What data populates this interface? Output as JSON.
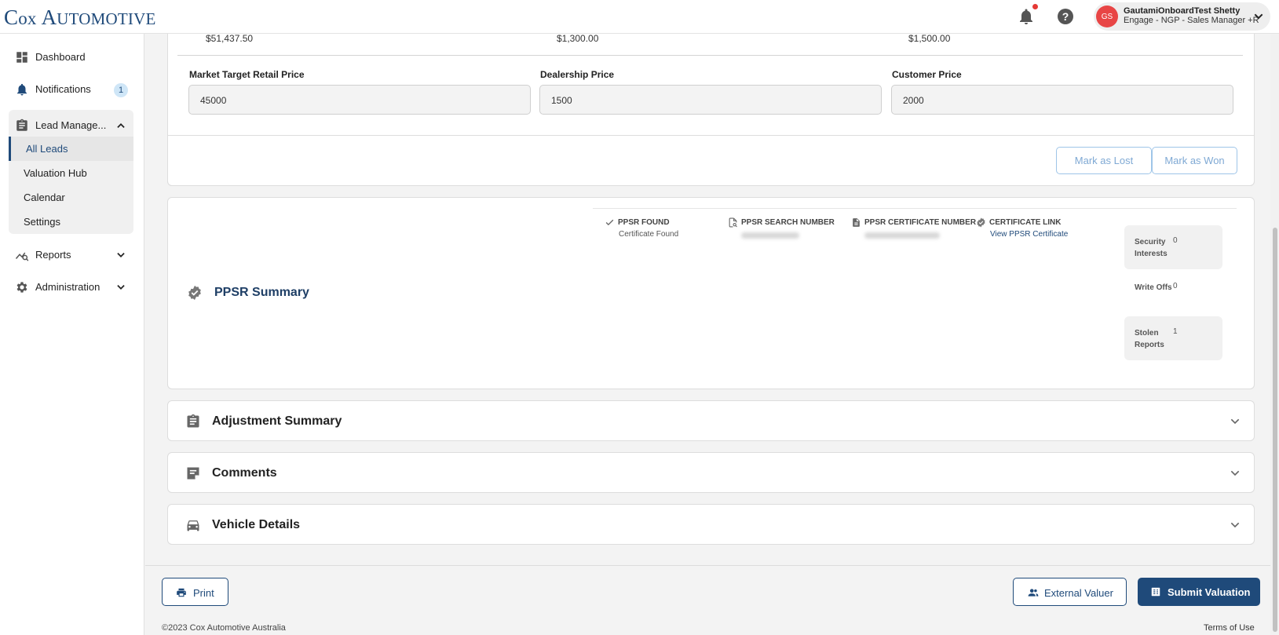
{
  "header": {
    "logo_first": "C",
    "logo_rest": "ox ",
    "logo_second": "A",
    "logo_rest2": "utomotive",
    "user": {
      "initials": "GS",
      "name": "GautamiOnboardTest Shetty",
      "role": "Engage - NGP - Sales Manager +R"
    }
  },
  "sidebar": {
    "dashboard": "Dashboard",
    "notifications": "Notifications",
    "notifications_count": "1",
    "lead_management": "Lead Manage...",
    "lead_items": [
      "All Leads",
      "Valuation Hub",
      "Calendar",
      "Settings"
    ],
    "reports": "Reports",
    "administration": "Administration"
  },
  "pricing": {
    "values": [
      "$51,437.50",
      "$1,300.00",
      "$1,500.00"
    ],
    "fields": [
      {
        "label": "Market Target Retail Price",
        "value": "45000"
      },
      {
        "label": "Dealership Price",
        "value": "1500"
      },
      {
        "label": "Customer Price",
        "value": "2000"
      }
    ],
    "mark_lost": "Mark as Lost",
    "mark_won": "Mark as Won"
  },
  "ppsr": {
    "title": "PPSR Summary",
    "found_label": "PPSR FOUND",
    "found_value": "Certificate Found",
    "search_label": "PPSR SEARCH NUMBER",
    "cert_label": "PPSR CERTIFICATE NUMBER",
    "link_label": "CERTIFICATE LINK",
    "link_text": "View PPSR Certificate",
    "stats": [
      {
        "label": "Security Interests",
        "value": "0"
      },
      {
        "label": "Write Offs",
        "value": "0"
      },
      {
        "label": "Stolen Reports",
        "value": "1"
      }
    ]
  },
  "sections": [
    "Adjustment Summary",
    "Comments",
    "Vehicle Details"
  ],
  "footer": {
    "print": "Print",
    "external_valuer": "External Valuer",
    "submit": "Submit Valuation",
    "copyright": "©2023 Cox Automotive Australia",
    "terms": "Terms of Use"
  }
}
